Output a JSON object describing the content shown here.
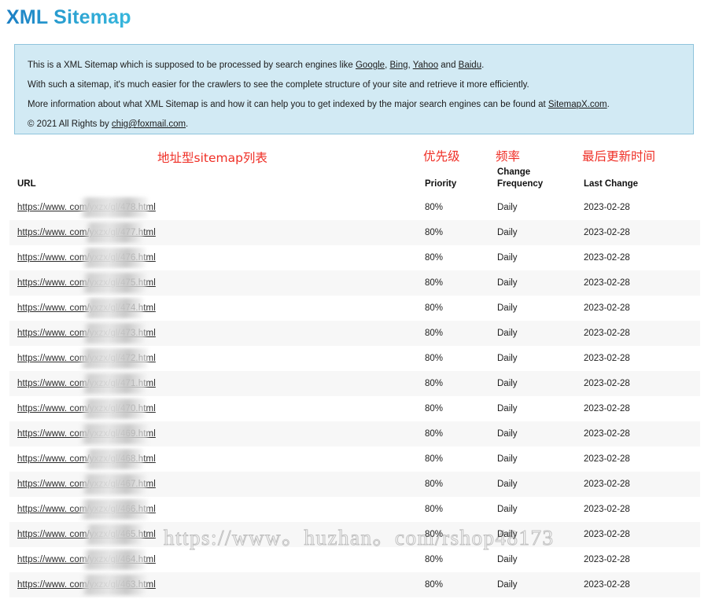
{
  "page": {
    "title": "XML Sitemap",
    "title_color": "#1c7fc4",
    "accent_color": "#37b7dd"
  },
  "info_box": {
    "background": "#d2eaf4",
    "border_color": "#8fc4dc",
    "line1_a": "This is a XML Sitemap which is supposed to be processed by search engines like ",
    "line1_link1": "Google",
    "line1_sep1": ", ",
    "line1_link2": "Bing",
    "line1_sep2": ", ",
    "line1_link3": "Yahoo",
    "line1_sep3": " and ",
    "line1_link4": "Baidu",
    "line1_end": ".",
    "line2": "With such a sitemap, it's much easier for the crawlers to see the complete structure of your site and retrieve it more efficiently.",
    "line3_a": "More information about what XML Sitemap is and how it can help you to get indexed by the major search engines can be found at ",
    "line3_link": "SitemapX.com",
    "line3_end": ".",
    "line4_a": "© 2021 All Rights by ",
    "line4_link": "chig@foxmail.com",
    "line4_end": "."
  },
  "annotations": {
    "color": "#ef2f26",
    "list_label": "地址型sitemap列表",
    "priority_label": "优先级",
    "frequency_label": "频率",
    "last_change_label": "最后更新时间"
  },
  "table": {
    "headers": {
      "url": "URL",
      "priority": "Priority",
      "change": "Change",
      "frequency": "Frequency",
      "last_change": "Last Change"
    },
    "url_prefix": "https://www.",
    "url_suffix_prefix": "com/yxzx/gl/",
    "url_extension": ".html",
    "rows": [
      {
        "url": "https://www.            com/yxzx/gl/478.html",
        "url_head": "https://www.",
        "url_tail": "com/yxzx/gl/478.html",
        "priority": "80%",
        "frequency": "Daily",
        "last_change": "2023-02-28"
      },
      {
        "url": "https://www.            com/yxzx/gl/477.html",
        "url_head": "https://www.",
        "url_tail": "com/yxzx/gl/477.html",
        "priority": "80%",
        "frequency": "Daily",
        "last_change": "2023-02-28"
      },
      {
        "url": "https://www.            com/yxzx/gl/476.html",
        "url_head": "https://www.",
        "url_tail": "com/yxzx/gl/476.html",
        "priority": "80%",
        "frequency": "Daily",
        "last_change": "2023-02-28"
      },
      {
        "url": "https://www.            com/yxzx/gl/475.html",
        "url_head": "https://www.",
        "url_tail": "com/yxzx/gl/475.html",
        "priority": "80%",
        "frequency": "Daily",
        "last_change": "2023-02-28"
      },
      {
        "url": "https://www.            com/yxzx/gl/474.html",
        "url_head": "https://www.",
        "url_tail": "com/yxzx/gl/474.html",
        "priority": "80%",
        "frequency": "Daily",
        "last_change": "2023-02-28"
      },
      {
        "url": "https://www.            com/yxzx/gl/473.html",
        "url_head": "https://www.",
        "url_tail": "com/yxzx/gl/473.html",
        "priority": "80%",
        "frequency": "Daily",
        "last_change": "2023-02-28"
      },
      {
        "url": "https://www.            com/yxzx/gl/472.html",
        "url_head": "https://www.",
        "url_tail": "com/yxzx/gl/472.html",
        "priority": "80%",
        "frequency": "Daily",
        "last_change": "2023-02-28"
      },
      {
        "url": "https://www.            com/yxzx/gl/471.html",
        "url_head": "https://www.",
        "url_tail": "com/yxzx/gl/471.html",
        "priority": "80%",
        "frequency": "Daily",
        "last_change": "2023-02-28"
      },
      {
        "url": "https://www.            com/yxzx/gl/470.html",
        "url_head": "https://www.",
        "url_tail": "com/yxzx/gl/470.html",
        "priority": "80%",
        "frequency": "Daily",
        "last_change": "2023-02-28"
      },
      {
        "url": "https://www.            com/yxzx/gl/469.html",
        "url_head": "https://www.",
        "url_tail": "com/yxzx/gl/469.html",
        "priority": "80%",
        "frequency": "Daily",
        "last_change": "2023-02-28"
      },
      {
        "url": "https://www.            com/yxzx/gl/468.html",
        "url_head": "https://www.",
        "url_tail": "com/yxzx/gl/468.html",
        "priority": "80%",
        "frequency": "Daily",
        "last_change": "2023-02-28"
      },
      {
        "url": "https://www.            com/yxzx/gl/467.html",
        "url_head": "https://www.",
        "url_tail": "com/yxzx/gl/467.html",
        "priority": "80%",
        "frequency": "Daily",
        "last_change": "2023-02-28"
      },
      {
        "url": "https://www.            com/yxzx/gl/466.html",
        "url_head": "https://www.",
        "url_tail": "com/yxzx/gl/466.html",
        "priority": "80%",
        "frequency": "Daily",
        "last_change": "2023-02-28"
      },
      {
        "url": "https://www.            com/yxzx/gl/465.html",
        "url_head": "https://www.",
        "url_tail": "com/yxzx/gl/465.html",
        "priority": "80%",
        "frequency": "Daily",
        "last_change": "2023-02-28"
      },
      {
        "url": "https://www.            com/yxzx/gl/464.html",
        "url_head": "https://www.",
        "url_tail": "com/yxzx/gl/464.html",
        "priority": "80%",
        "frequency": "Daily",
        "last_change": "2023-02-28"
      },
      {
        "url": "https://www.            com/yxzx/gl/463.html",
        "url_head": "https://www.",
        "url_tail": "com/yxzx/gl/463.html",
        "priority": "80%",
        "frequency": "Daily",
        "last_change": "2023-02-28"
      }
    ]
  },
  "watermark": {
    "text": "https://www。huzhan。com/rshop48173"
  }
}
